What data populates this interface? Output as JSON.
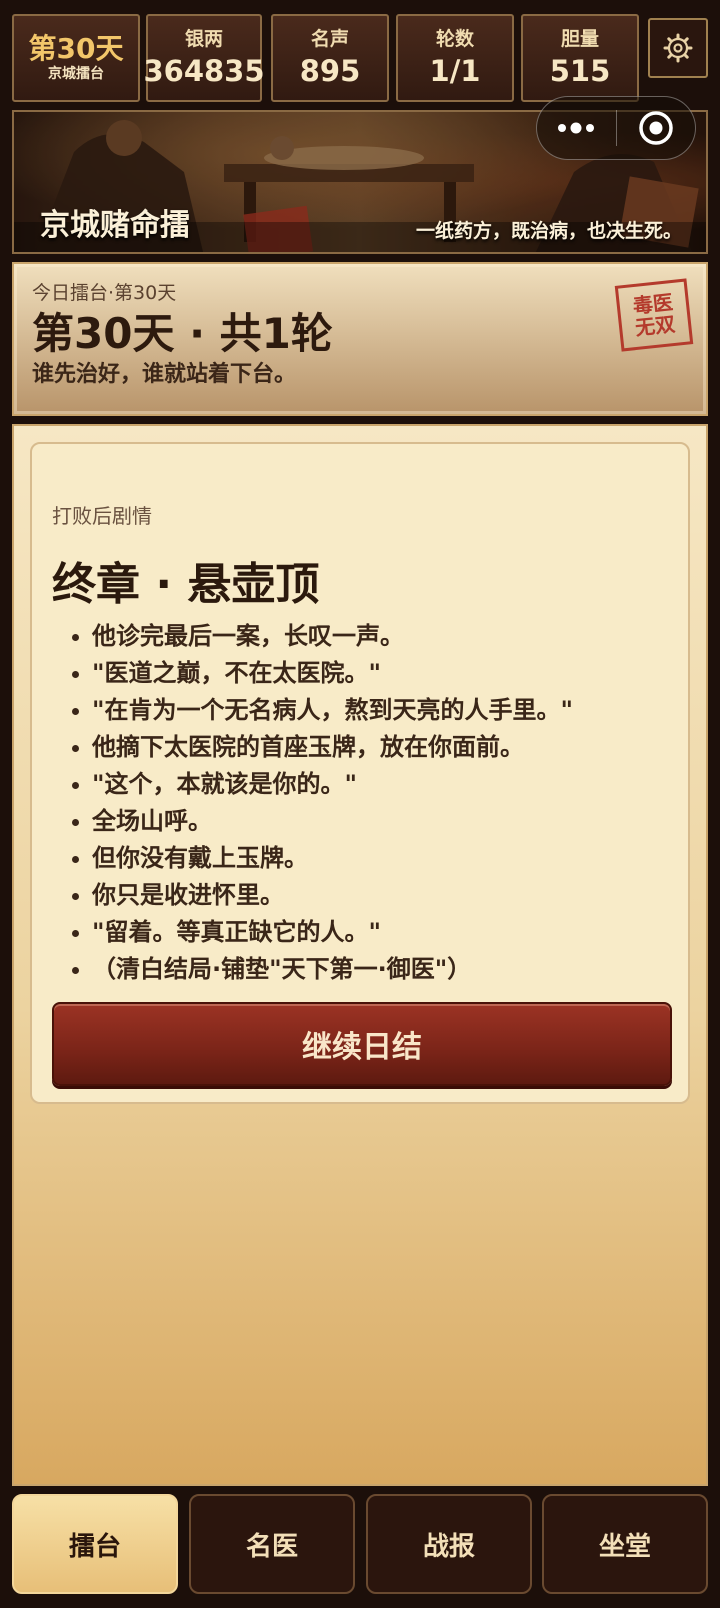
{
  "stats": {
    "day_big": "第30天",
    "day_small": "京城擂台",
    "items": [
      {
        "label": "银两",
        "value": "364835"
      },
      {
        "label": "名声",
        "value": "895"
      },
      {
        "label": "轮数",
        "value": "1/1"
      },
      {
        "label": "胆量",
        "value": "515"
      }
    ]
  },
  "icons": {
    "settings": "gear-icon",
    "more": "more-dots-icon",
    "close": "target-circle-icon"
  },
  "banner": {
    "title": "京城赌命擂",
    "tagline": "一纸药方，既治病，也决生死。"
  },
  "header": {
    "sub": "今日擂台·第30天",
    "main": "第30天 · 共1轮",
    "desc": "谁先治好，谁就站着下台。",
    "stamp_line1": "毒医",
    "stamp_line2": "无双"
  },
  "story": {
    "kicker": "打败后剧情",
    "chapter": "终章 · 悬壶顶",
    "lines": [
      "他诊完最后一案，长叹一声。",
      "\"医道之巅，不在太医院。\"",
      "\"在肯为一个无名病人，熬到天亮的人手里。\"",
      "他摘下太医院的首座玉牌，放在你面前。",
      "\"这个，本就该是你的。\"",
      "全场山呼。",
      "但你没有戴上玉牌。",
      "你只是收进怀里。",
      "\"留着。等真正缺它的人。\"",
      "（清白结局·铺垫\"天下第一·御医\"）"
    ],
    "continue_label": "继续日结"
  },
  "nav": {
    "tabs": [
      "擂台",
      "名医",
      "战报",
      "坐堂"
    ],
    "active": "擂台"
  },
  "colors": {
    "accent_red": "#8a2a1c",
    "stamp_red": "#b43a2c",
    "gold": "#f2c66a",
    "panel_bg": "#f6e7c4"
  }
}
